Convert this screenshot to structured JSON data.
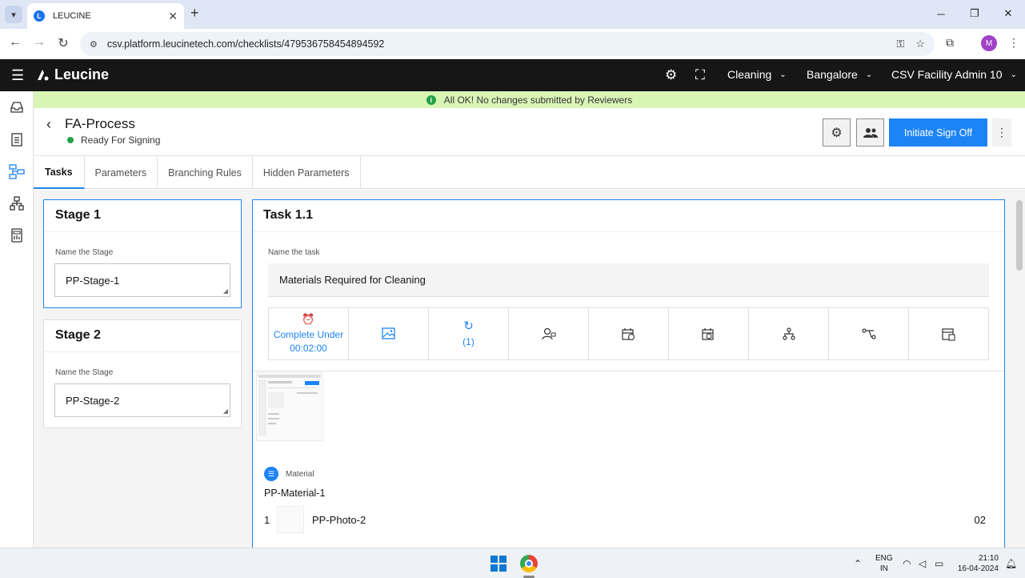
{
  "browser": {
    "tab_title": "LEUCINE",
    "url": "csv.platform.leucinetech.com/checklists/479536758454894592",
    "profile_initial": "M"
  },
  "header": {
    "brand": "Leucine",
    "facility_select": "Cleaning",
    "location_select": "Bangalore",
    "user_select": "CSV Facility Admin 10"
  },
  "banner": {
    "message": "All OK! No changes submitted by Reviewers",
    "color": "#d8f5b6"
  },
  "process": {
    "title": "FA-Process",
    "status": "Ready For Signing",
    "primary_action": "Initiate Sign Off"
  },
  "tabs": [
    {
      "label": "Tasks",
      "active": true
    },
    {
      "label": "Parameters",
      "active": false
    },
    {
      "label": "Branching Rules",
      "active": false
    },
    {
      "label": "Hidden Parameters",
      "active": false
    }
  ],
  "stages": [
    {
      "title": "Stage 1",
      "field_label": "Name the Stage",
      "value": "PP-Stage-1"
    },
    {
      "title": "Stage 2",
      "field_label": "Name the Stage",
      "value": "PP-Stage-2"
    }
  ],
  "task": {
    "title": "Task 1.1",
    "field_label": "Name the task",
    "name": "Materials Required for Cleaning",
    "timer_label": "Complete Under",
    "timer_value": "00:02:00",
    "recurrence_count": "(1)",
    "material_section_label": "Material",
    "material_name": "PP-Material-1",
    "material_items": [
      {
        "index": "1",
        "name": "PP-Photo-2",
        "qty": "02"
      }
    ]
  },
  "taskbar": {
    "lang_top": "ENG",
    "lang_bottom": "IN",
    "time": "21:10",
    "date": "16-04-2024"
  },
  "colors": {
    "primary": "#1d84f5",
    "header_bg": "#161616",
    "status_green": "#24a148"
  }
}
